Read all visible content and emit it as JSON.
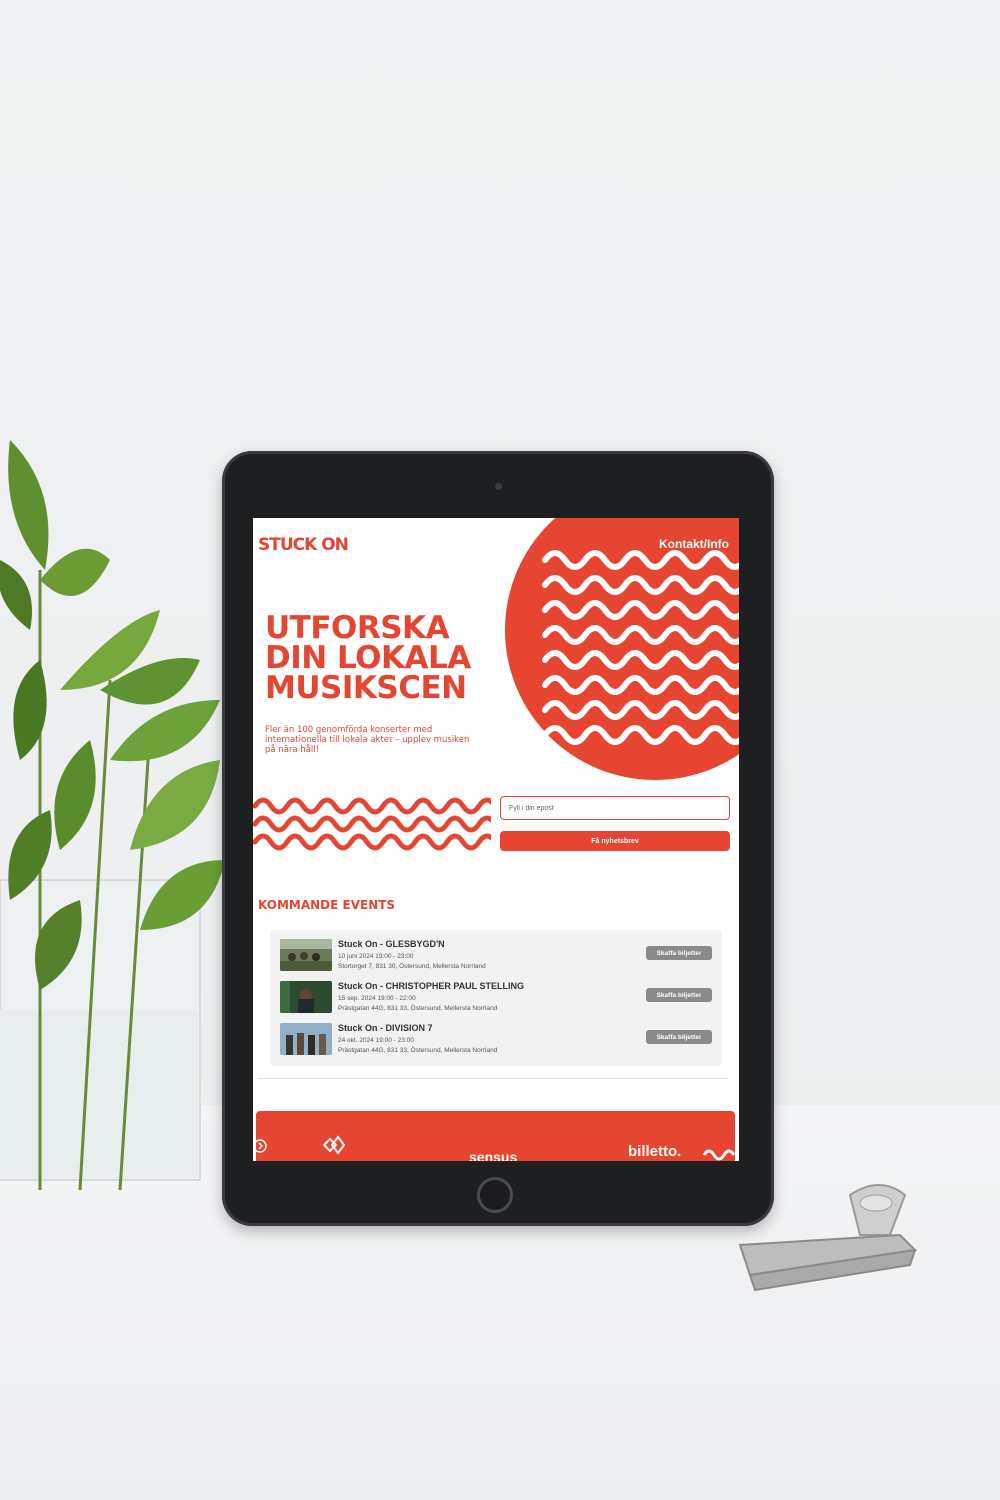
{
  "site": {
    "logo": "STUCK ON",
    "nav_link": "Kontakt/Info"
  },
  "hero": {
    "line1": "UTFORSKA",
    "line2": "DIN LOKALA",
    "line3": "MUSIKSCEN",
    "subtitle": "Fler än 100 genomförda konserter med internationella till lokala akter – upplev musiken på nära håll!"
  },
  "newsletter": {
    "placeholder": "Fyll i din epost",
    "button": "Få nyhetsbrev"
  },
  "events": {
    "title": "KOMMANDE EVENTS",
    "items": [
      {
        "title": "Stuck On - GLESBYGD'N",
        "date": "10 juni 2024 19:00 - 23:00",
        "address": "Stortorget 7, 831 30, Östersund, Mellersta Norrland",
        "button": "Skaffa biljetter"
      },
      {
        "title": "Stuck On - CHRISTOPHER PAUL STELLING",
        "date": "15 sep. 2024 19:00 - 22:00",
        "address": "Prästgatan 44G, 831 33, Östersund, Mellersta Norrland",
        "button": "Skaffa biljetter"
      },
      {
        "title": "Stuck On - DIVISION 7",
        "date": "24 okt. 2024 19:00 - 23:00",
        "address": "Prästgatan 44G, 831 33, Östersund, Mellersta Norrland",
        "button": "Skaffa biljetter"
      }
    ]
  },
  "footer": {
    "partners": [
      "sensus",
      "billetto."
    ]
  },
  "colors": {
    "accent": "#e64631",
    "button_gray": "#8a8a8a",
    "background": "#f1f2f3",
    "device": "#1e1f21"
  }
}
